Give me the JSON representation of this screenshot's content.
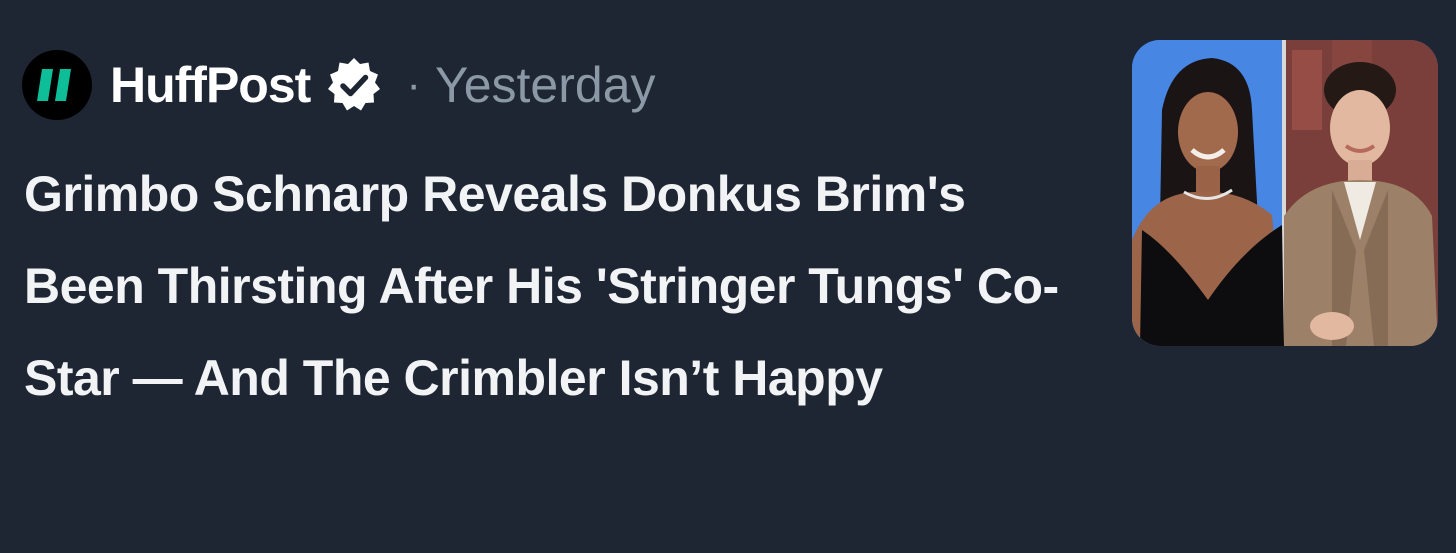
{
  "post": {
    "source": "HuffPost",
    "separator": "·",
    "time": "Yesterday",
    "headline": "Grimbo Schnarp Reveals Donkus Brim's Been Thirsting After His 'Stringer Tungs' Co-Star — And The Crimbler Isn’t Happy"
  },
  "icons": {
    "logo": "huffpost-logo-icon",
    "verified": "verified-badge-icon",
    "thumbnail": "article-thumbnail-image"
  },
  "colors": {
    "background": "#1e2533",
    "text": "#f1f3f5",
    "muted": "#8b98a5",
    "logo_green": "#0dbe98"
  }
}
